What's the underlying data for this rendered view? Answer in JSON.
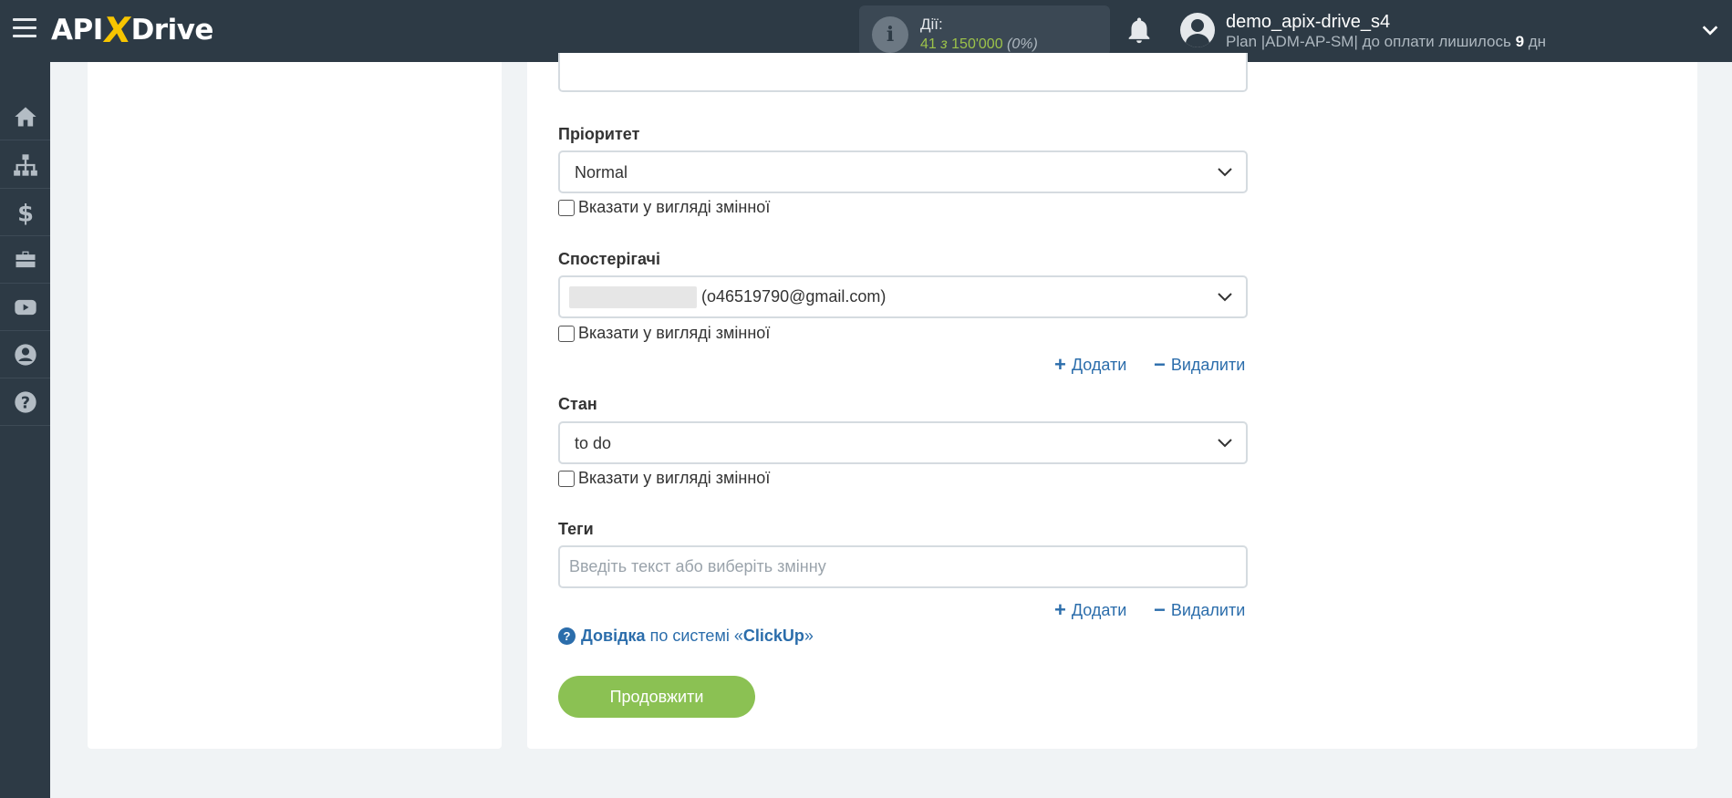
{
  "header": {
    "logo": {
      "api": "API",
      "x": "X",
      "drive": "Drive"
    },
    "actions": {
      "label": "Дії:",
      "used": "41",
      "sep": "з",
      "total": "150'000",
      "percent": "(0%)"
    },
    "user": {
      "name": "demo_apix-drive_s4",
      "plan_prefix": "Plan |ADM-AP-SM| до оплати лишилось",
      "days": "9",
      "days_unit": "дн"
    }
  },
  "sidebar": {
    "items": [
      {
        "icon": "home-icon"
      },
      {
        "icon": "sitemap-icon"
      },
      {
        "icon": "dollar-icon"
      },
      {
        "icon": "briefcase-icon"
      },
      {
        "icon": "youtube-icon"
      },
      {
        "icon": "user-circle-icon"
      },
      {
        "icon": "question-circle-icon"
      }
    ]
  },
  "form": {
    "priority": {
      "label": "Пріоритет",
      "value": "Normal",
      "checkbox_label": "Вказати у вигляді змінної",
      "checked": false
    },
    "watchers": {
      "label": "Спостерігачі",
      "value": "(o46519790@gmail.com)",
      "checkbox_label": "Вказати у вигляді змінної",
      "checked": false,
      "add_label": "Додати",
      "remove_label": "Видалити"
    },
    "status": {
      "label": "Стан",
      "value": "to do",
      "checkbox_label": "Вказати у вигляді змінної",
      "checked": false
    },
    "tags": {
      "label": "Теги",
      "placeholder": "Введіть текст або виберіть змінну",
      "value": "",
      "add_label": "Додати",
      "remove_label": "Видалити"
    },
    "help": {
      "bold": "Довідка",
      "middle": "по системі «",
      "system": "ClickUp",
      "end": "»"
    },
    "continue_label": "Продовжити"
  },
  "colors": {
    "topbar": "#2d3a45",
    "accent_yellow": "#f7c500",
    "link_blue": "#2b6dab",
    "button_green": "#8bc153",
    "count_green": "#9cc24a"
  }
}
